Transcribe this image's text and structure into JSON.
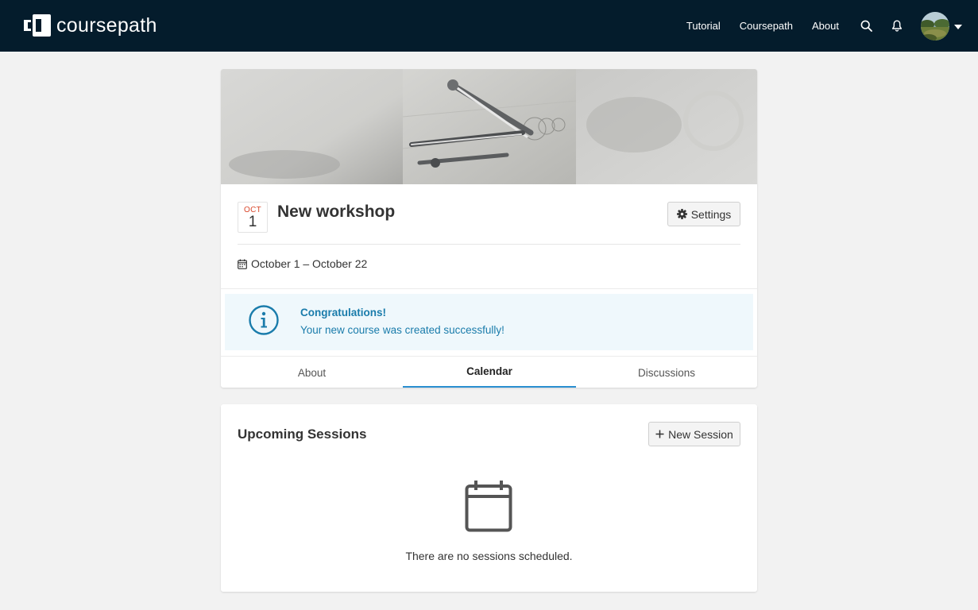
{
  "header": {
    "logo_text": "coursepath",
    "nav": {
      "tutorial": "Tutorial",
      "coursepath": "Coursepath",
      "about": "About"
    },
    "icons": {
      "search": "search-icon",
      "notifications": "bell-icon",
      "avatar_menu": "chevron-down-icon"
    }
  },
  "course": {
    "date_badge": {
      "month": "OCT",
      "day": "1"
    },
    "title": "New workshop",
    "settings_label": "Settings",
    "date_range": "October 1 – October 22"
  },
  "alert": {
    "title": "Congratulations!",
    "message": "Your new course was created successfully!"
  },
  "tabs": [
    {
      "label": "About",
      "active": false
    },
    {
      "label": "Calendar",
      "active": true
    },
    {
      "label": "Discussions",
      "active": false
    }
  ],
  "sessions": {
    "title": "Upcoming Sessions",
    "new_session_label": "New Session",
    "empty_message": "There are no sessions scheduled."
  },
  "colors": {
    "topbar": "#041c2c",
    "accent": "#2a8fd0",
    "alert_text": "#1a7cab",
    "alert_bg": "#eff8fc",
    "date_month": "#d9472b"
  }
}
